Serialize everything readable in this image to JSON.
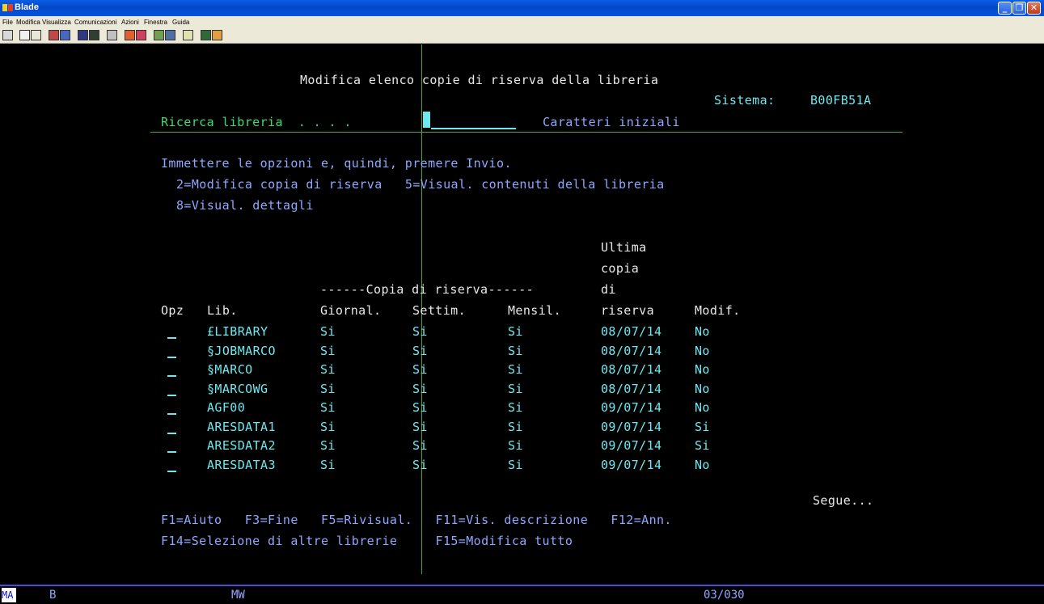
{
  "window": {
    "title": "Blade"
  },
  "menu": [
    "File",
    "Modifica",
    "Visualizza",
    "Comunicazioni",
    "Azioni",
    "Finestra",
    "Guida"
  ],
  "screen": {
    "title": "Modifica elenco copie di riserva della libreria",
    "system_label": "Sistema:",
    "system_value": "B00FB51A",
    "search_label": "Ricerca libreria  . . . .",
    "search_hint": "Caratteri iniziali",
    "instructions": "Immettere le opzioni e, quindi, premere Invio.",
    "options_line1": "2=Modifica copia di riserva   5=Visual. contenuti della libreria",
    "options_line2": "8=Visual. dettagli",
    "header_group": "------Copia di riserva------",
    "header_last1": "Ultima",
    "header_last2": "copia",
    "header_last3": "di",
    "columns": {
      "opz": "Opz",
      "lib": "Lib.",
      "daily": "Giornal.",
      "weekly": "Settim.",
      "monthly": "Mensil.",
      "last": "riserva",
      "modified": "Modif."
    },
    "rows": [
      {
        "lib": "£LIBRARY",
        "daily": "Si",
        "weekly": "Si",
        "monthly": "Si",
        "date": "08/07/14",
        "mod": "No"
      },
      {
        "lib": "§JOBMARCO",
        "daily": "Si",
        "weekly": "Si",
        "monthly": "Si",
        "date": "08/07/14",
        "mod": "No"
      },
      {
        "lib": "§MARCO",
        "daily": "Si",
        "weekly": "Si",
        "monthly": "Si",
        "date": "08/07/14",
        "mod": "No"
      },
      {
        "lib": "§MARCOWG",
        "daily": "Si",
        "weekly": "Si",
        "monthly": "Si",
        "date": "08/07/14",
        "mod": "No"
      },
      {
        "lib": "AGF00",
        "daily": "Si",
        "weekly": "Si",
        "monthly": "Si",
        "date": "09/07/14",
        "mod": "No"
      },
      {
        "lib": "ARESDATA1",
        "daily": "Si",
        "weekly": "Si",
        "monthly": "Si",
        "date": "09/07/14",
        "mod": "Si"
      },
      {
        "lib": "ARESDATA2",
        "daily": "Si",
        "weekly": "Si",
        "monthly": "Si",
        "date": "09/07/14",
        "mod": "Si"
      },
      {
        "lib": "ARESDATA3",
        "daily": "Si",
        "weekly": "Si",
        "monthly": "Si",
        "date": "09/07/14",
        "mod": "No"
      }
    ],
    "more": "Segue...",
    "fkeys_line1": "F1=Aiuto   F3=Fine   F5=Rivisual.   F11=Vis. descrizione   F12=Ann.",
    "fkeys_line2": "F14=Selezione di altre librerie     F15=Modifica tutto"
  },
  "status": {
    "mode": "MA",
    "b": "B",
    "mw": "MW",
    "cursor": "03/030"
  }
}
